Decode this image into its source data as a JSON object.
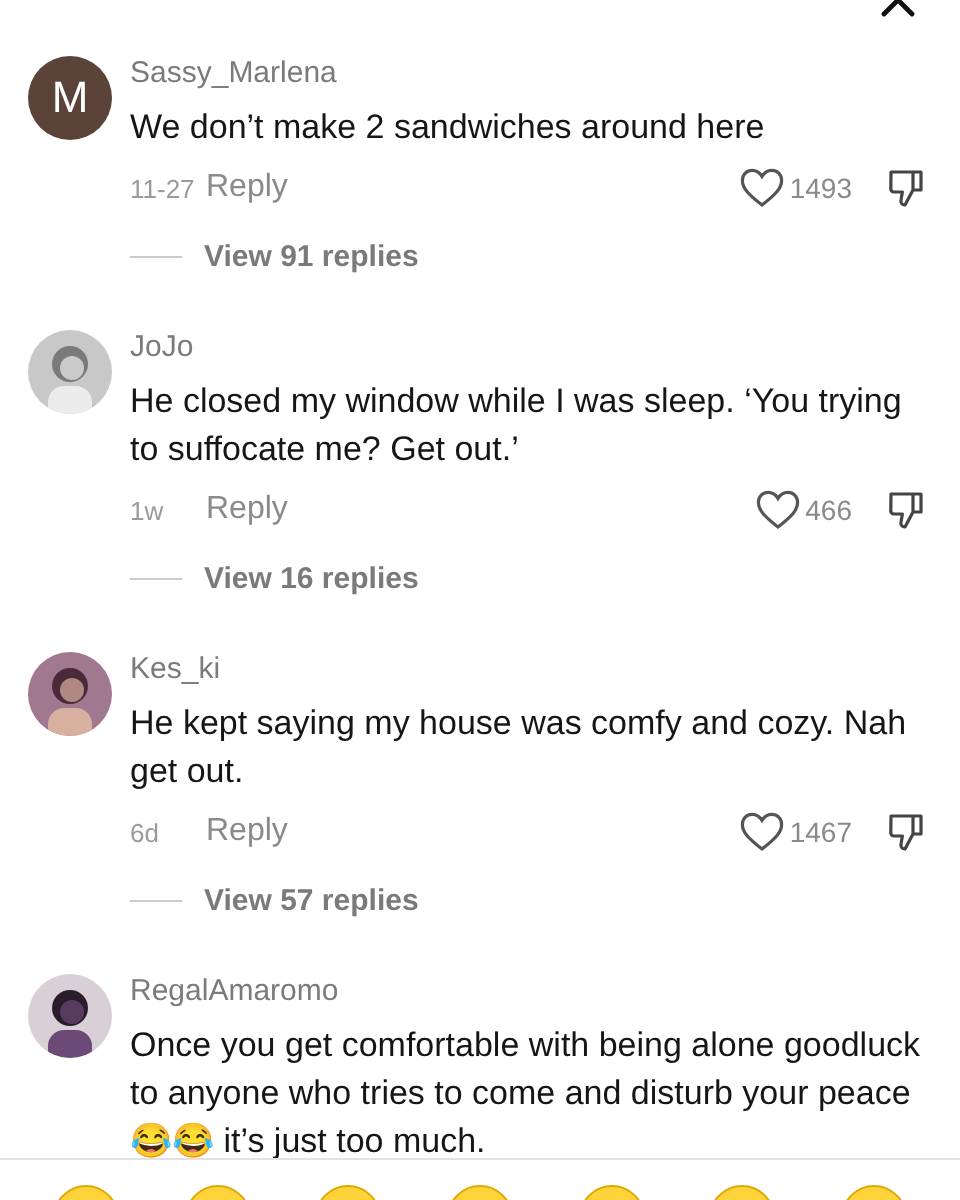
{
  "comments": [
    {
      "author": "Sassy_Marlena",
      "avatar": {
        "kind": "letter",
        "letter": "M",
        "color": "#5b4339"
      },
      "text": "We don’t make 2 sandwiches around here",
      "time": "11-27",
      "reply": "Reply",
      "likes": "1493",
      "liked": false,
      "view_replies": "View 91 replies"
    },
    {
      "author": "JoJo",
      "text": "He closed my window while I was sleep. ‘You trying to suffocate me? Get out.’",
      "time": "1w",
      "reply": "Reply",
      "likes": "466",
      "liked": false,
      "view_replies": "View 16 replies"
    },
    {
      "author": "Kes_ki",
      "text": "He kept saying my house was comfy and cozy. Nah get out.",
      "time": "6d",
      "reply": "Reply",
      "likes": "1467",
      "liked": false,
      "view_replies": "View 57 replies"
    },
    {
      "author": "RegalAmaromo",
      "text": "Once you get comfortable with being alone goodluck to anyone who tries to come and disturb your peace 😂😂 it’s just too much."
    }
  ]
}
